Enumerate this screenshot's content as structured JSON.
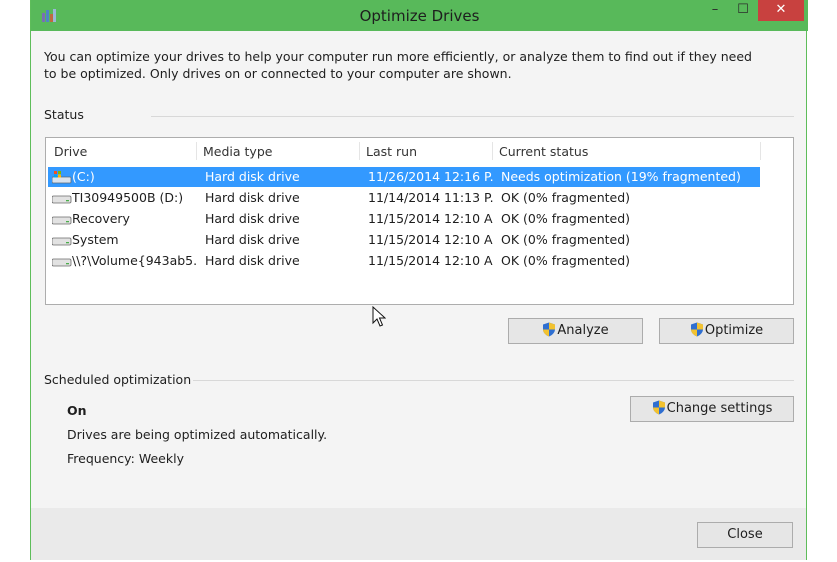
{
  "window": {
    "title": "Optimize Drives",
    "minimize_glyph": "–",
    "maximize_glyph": "☐",
    "close_glyph": "✕"
  },
  "intro_text": "You can optimize your drives to help your computer run more efficiently, or analyze them to find out if they need to be optimized. Only drives on or connected to your computer are shown.",
  "status": {
    "label": "Status",
    "columns": [
      "Drive",
      "Media type",
      "Last run",
      "Current status"
    ],
    "rows": [
      {
        "drive": "(C:)",
        "media": "Hard disk drive",
        "last_run": "11/26/2014 12:16 P...",
        "status": "Needs optimization (19% fragmented)",
        "icon": "system-drive-icon"
      },
      {
        "drive": "TI30949500B (D:)",
        "media": "Hard disk drive",
        "last_run": "11/14/2014 11:13 P...",
        "status": "OK (0% fragmented)",
        "icon": "hard-drive-icon"
      },
      {
        "drive": "Recovery",
        "media": "Hard disk drive",
        "last_run": "11/15/2014 12:10 A...",
        "status": "OK (0% fragmented)",
        "icon": "hard-drive-icon"
      },
      {
        "drive": "System",
        "media": "Hard disk drive",
        "last_run": "11/15/2014 12:10 A...",
        "status": "OK (0% fragmented)",
        "icon": "hard-drive-icon"
      },
      {
        "drive": "\\\\?\\Volume{943ab5...",
        "media": "Hard disk drive",
        "last_run": "11/15/2014 12:10 A...",
        "status": "OK (0% fragmented)",
        "icon": "hard-drive-icon"
      }
    ],
    "selected_index": 0
  },
  "buttons": {
    "analyze": "Analyze",
    "optimize": "Optimize",
    "change_settings": "Change settings",
    "close": "Close"
  },
  "scheduled": {
    "label": "Scheduled optimization",
    "state": "On",
    "description": "Drives are being optimized automatically.",
    "frequency": "Frequency: Weekly"
  },
  "colors": {
    "titlebar": "#58b95a",
    "selection": "#3399ff",
    "close_button": "#c8413f"
  }
}
